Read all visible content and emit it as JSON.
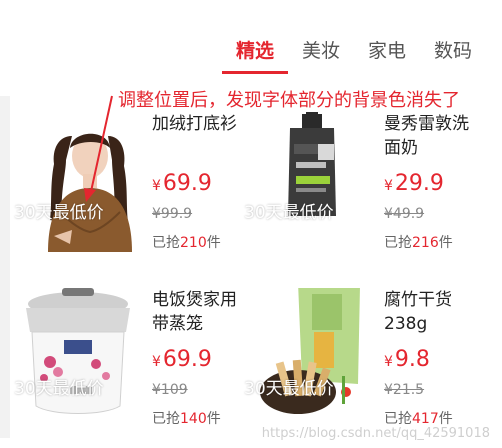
{
  "tabs": [
    {
      "label": "精选",
      "active": true
    },
    {
      "label": "美妆",
      "active": false
    },
    {
      "label": "家电",
      "active": false
    },
    {
      "label": "数码",
      "active": false
    }
  ],
  "annotation": "调整位置后，发现字体部分的背景色消失了",
  "products": [
    {
      "name": "加绒打底衫",
      "yen": "¥",
      "price": "69.9",
      "old_price": "¥99.9",
      "sold_prefix": "已抢",
      "sold_count": "210",
      "sold_suffix": "件",
      "tag": "30天最低价",
      "icon": "woman-blouse-image"
    },
    {
      "name": "曼秀雷敦洗面奶",
      "yen": "¥",
      "price": "29.9",
      "old_price": "¥49.9",
      "sold_prefix": "已抢",
      "sold_count": "216",
      "sold_suffix": "件",
      "tag": "30天最低价",
      "icon": "face-wash-bottle-image"
    },
    {
      "name": "电饭煲家用带蒸笼",
      "yen": "¥",
      "price": "69.9",
      "old_price": "¥109",
      "sold_prefix": "已抢",
      "sold_count": "140",
      "sold_suffix": "件",
      "tag": "30天最低价",
      "icon": "rice-cooker-image"
    },
    {
      "name": "腐竹干货238g",
      "yen": "¥",
      "price": "9.8",
      "old_price": "¥21.5",
      "sold_prefix": "已抢",
      "sold_count": "417",
      "sold_suffix": "件",
      "tag": "30天最低价",
      "icon": "dried-tofu-skin-image"
    }
  ],
  "watermark": "https://blog.csdn.net/qq_42591018",
  "colors": {
    "accent": "#e4262f"
  }
}
